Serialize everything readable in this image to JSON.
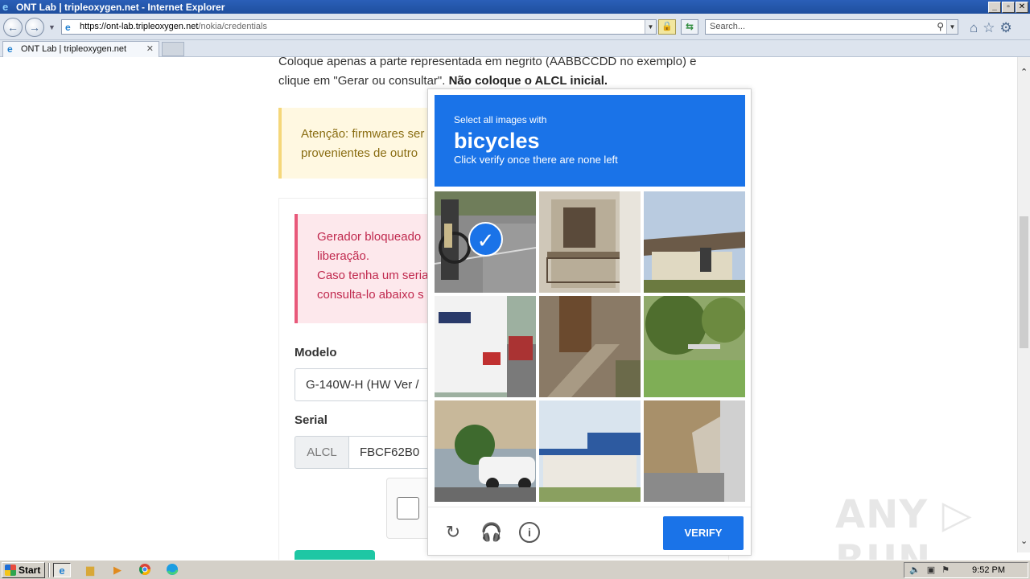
{
  "window": {
    "title": "ONT Lab | tripleoxygen.net - Internet Explorer",
    "controls": [
      "_",
      "▫",
      "✕"
    ]
  },
  "toolbar": {
    "url_prefix": "https://",
    "url_host": "ont-lab.tripleoxygen.net",
    "url_path": "/nokia/credentials",
    "search_placeholder": "Search..."
  },
  "tabs": [
    {
      "label": "ONT Lab | tripleoxygen.net",
      "close": "✕"
    }
  ],
  "page": {
    "intro_part1": "Coloque apenas a parte representada em negrito (AABBCCDD no exemplo) e clique em \"Gerar ou consultar\". ",
    "intro_bold": "Não coloque o ALCL inicial.",
    "warning_line1": "Atenção: firmwares ser",
    "warning_line2": "provenientes de outro",
    "danger_line1": "Gerador bloqueado",
    "danger_line2": "liberação.",
    "danger_line3": "Caso tenha um seria",
    "danger_line4": "consulta-lo abaixo s",
    "modelo_label": "Modelo",
    "modelo_value": "G-140W-H (HW Ver /",
    "serial_label": "Serial",
    "serial_prefix": "ALCL",
    "serial_value": "FBCF62B0"
  },
  "captcha": {
    "prompt_small": "Select all images with",
    "prompt_big": "bicycles",
    "prompt_hint": "Click verify once there are none left",
    "verify_label": "VERIFY",
    "tiles": [
      {
        "name": "bicycle-tile",
        "selected": true
      },
      {
        "name": "balcony-tile",
        "selected": false
      },
      {
        "name": "house-roof-tile",
        "selected": false
      },
      {
        "name": "bus-tile",
        "selected": false
      },
      {
        "name": "stairs-tile",
        "selected": false
      },
      {
        "name": "tree-yard-tile",
        "selected": false
      },
      {
        "name": "white-car-tile",
        "selected": false
      },
      {
        "name": "building-tile",
        "selected": false
      },
      {
        "name": "garage-tile",
        "selected": false
      }
    ]
  },
  "watermark": "ANY ▷ RUN",
  "taskbar": {
    "start_label": "Start",
    "clock": "9:52 PM"
  },
  "colors": {
    "captcha_blue": "#1a73e8",
    "warning_bg": "#fff8e1",
    "danger_text": "#c0294e",
    "titlebar": "#2a5fb8"
  }
}
